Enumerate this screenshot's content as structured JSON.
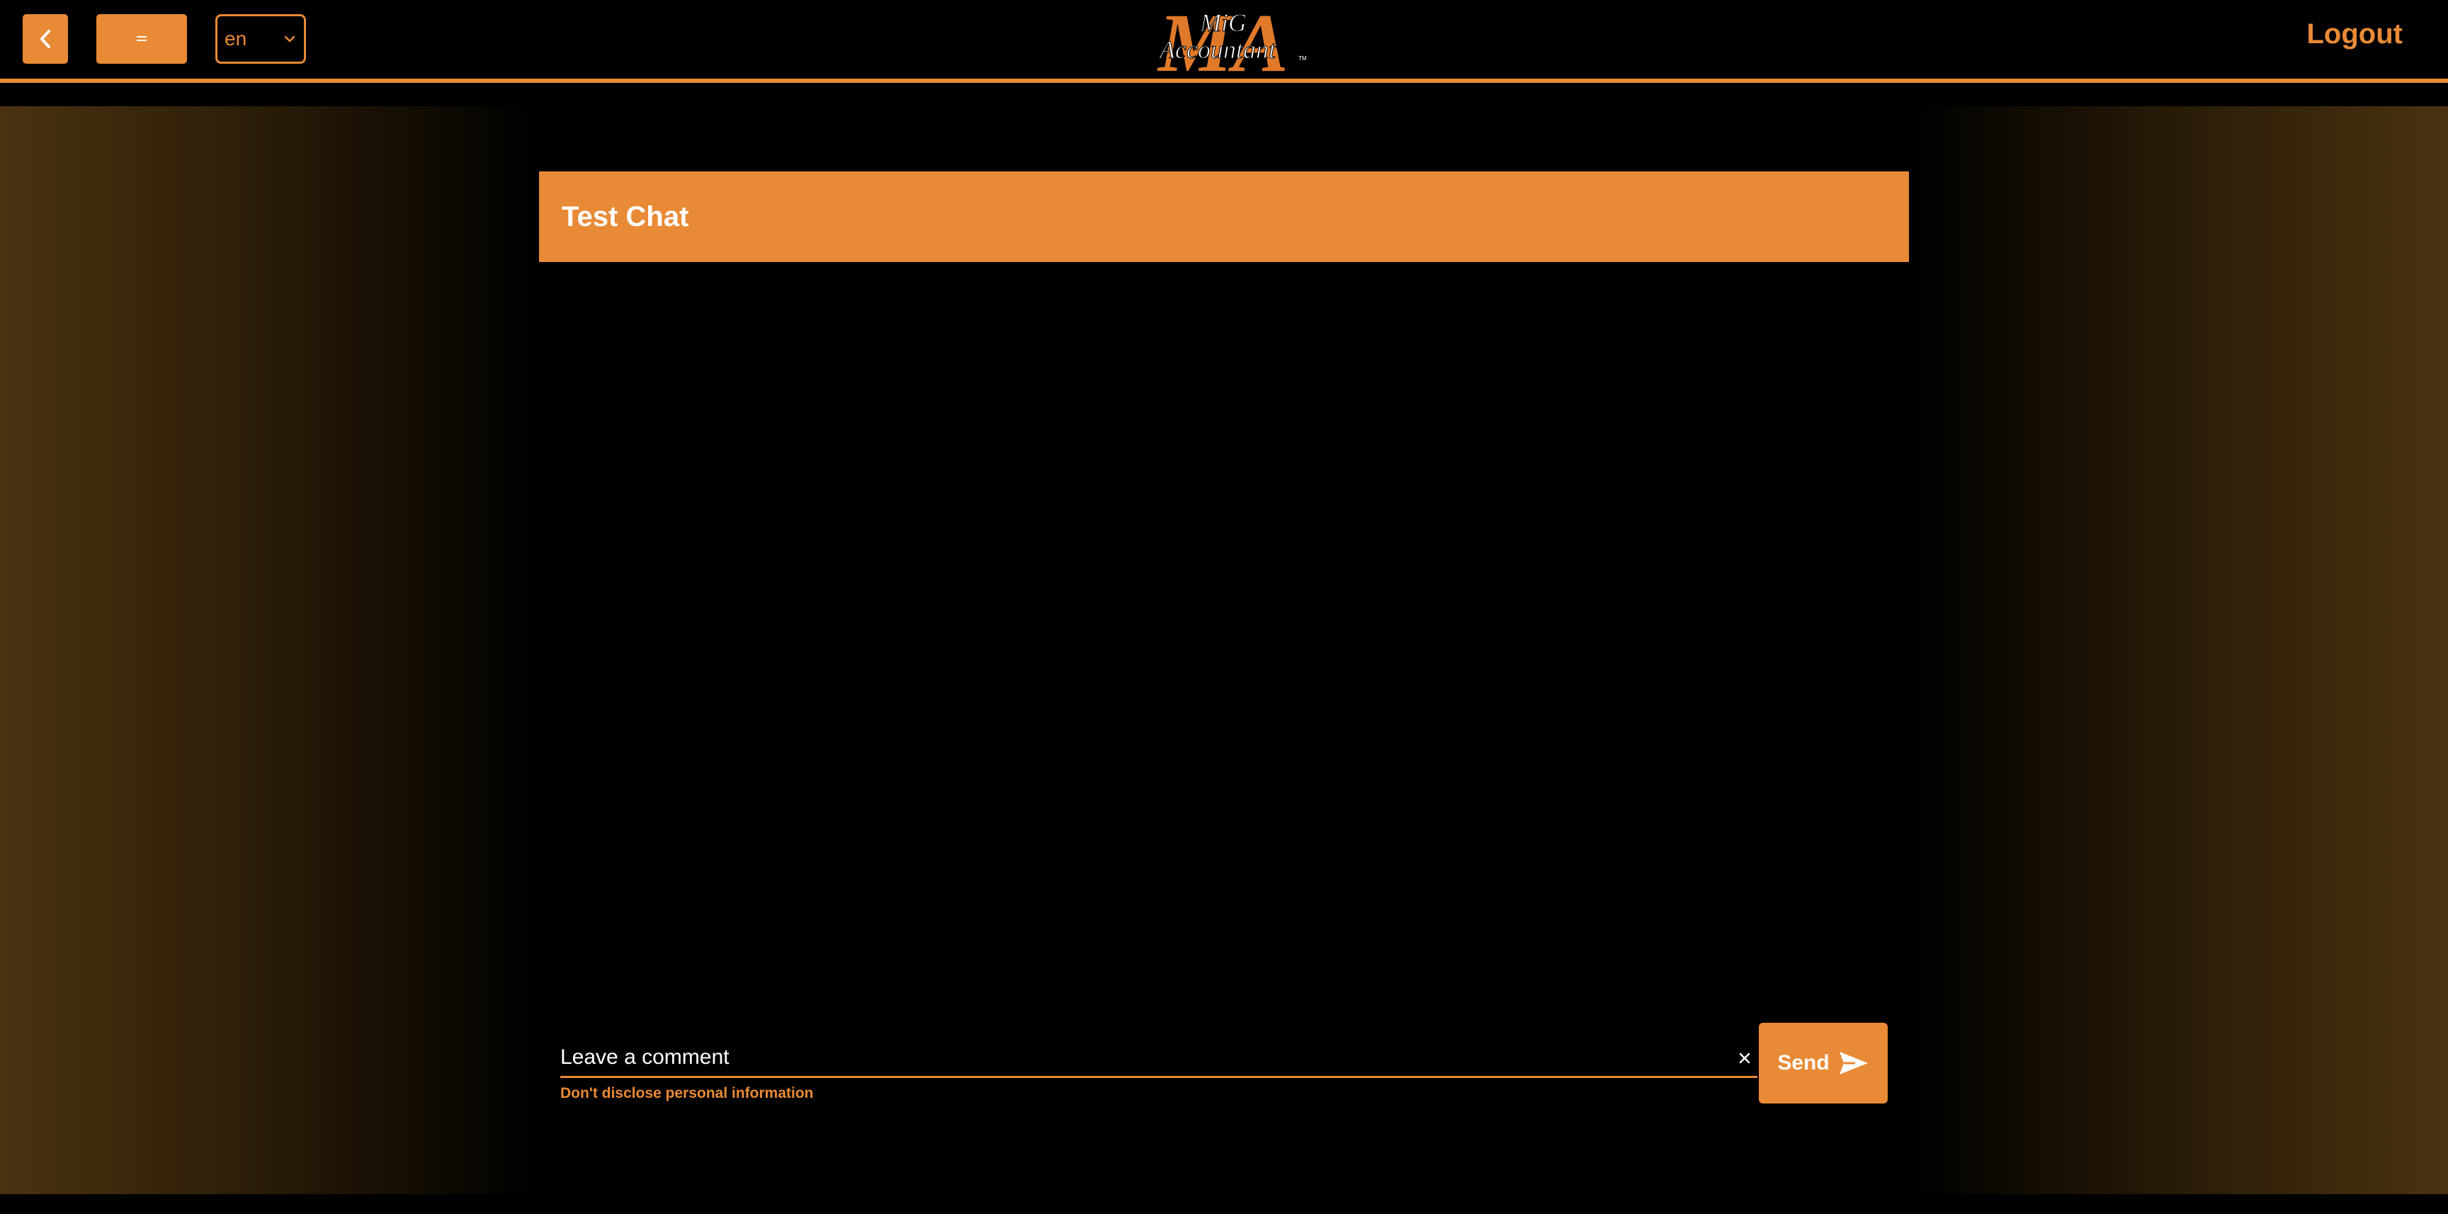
{
  "header": {
    "language": "en",
    "logout_label": "Logout",
    "logo": {
      "line1": "MiG",
      "line2": "Accountant",
      "tm": "TM",
      "big_letters": "MA"
    }
  },
  "chat": {
    "title": "Test Chat",
    "comment_placeholder": "Leave a comment",
    "comment_value": "",
    "hint": "Don't disclose personal information",
    "send_label": "Send"
  },
  "icons": {
    "back": "chevron-left-icon",
    "menu": "hamburger-icon",
    "dropdown": "chevron-down-icon",
    "clear": "close-icon",
    "send": "send-icon"
  },
  "colors": {
    "accent": "#e88a36",
    "background": "#000000",
    "text_on_accent": "#ffffff"
  }
}
